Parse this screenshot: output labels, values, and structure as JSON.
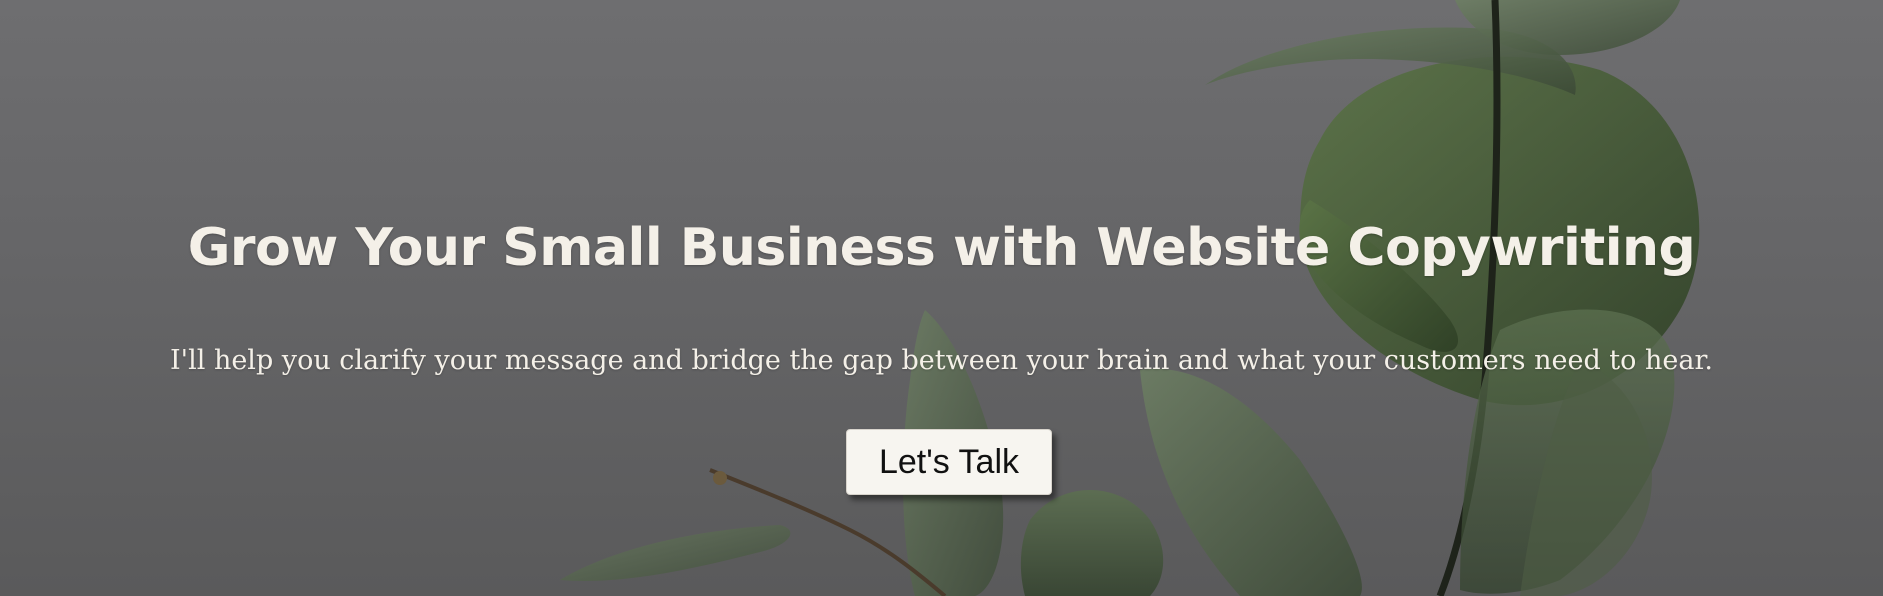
{
  "hero": {
    "headline": "Grow Your Small Business with Website Copywriting",
    "subheadline": "I'll help you clarify your message and bridge the gap between your brain and what your customers need to hear.",
    "cta_label": "Let's Talk",
    "background_image": "eucalyptus-plant-photo"
  },
  "colors": {
    "background": "#666668",
    "text": "#f4f0e8",
    "button_bg": "#f7f5f0",
    "button_text": "#111111",
    "leaf": "#3d5230"
  }
}
